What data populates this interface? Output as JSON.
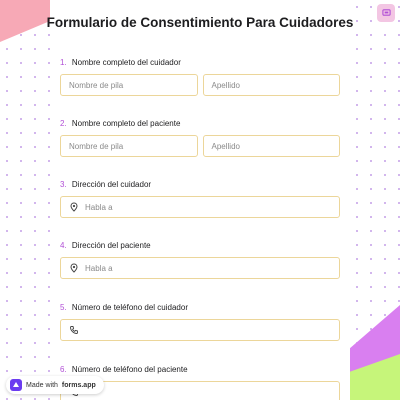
{
  "form": {
    "title": "Formulario de Consentimiento Para Cuidadores"
  },
  "questions": [
    {
      "number": "1.",
      "label": "Nombre completo del cuidador",
      "fields": [
        {
          "placeholder": "Nombre de pila"
        },
        {
          "placeholder": "Apellido"
        }
      ]
    },
    {
      "number": "2.",
      "label": "Nombre completo del paciente",
      "fields": [
        {
          "placeholder": "Nombre de pila"
        },
        {
          "placeholder": "Apellido"
        }
      ]
    },
    {
      "number": "3.",
      "label": "Dirección del cuidador",
      "fields": [
        {
          "placeholder": "Habla a",
          "icon": "location-pin-icon"
        }
      ]
    },
    {
      "number": "4.",
      "label": "Dirección del paciente",
      "fields": [
        {
          "placeholder": "Habla a",
          "icon": "location-pin-icon"
        }
      ]
    },
    {
      "number": "5.",
      "label": "Número de teléfono del cuidador",
      "fields": [
        {
          "placeholder": "",
          "icon": "phone-icon"
        }
      ]
    },
    {
      "number": "6.",
      "label": "Número de teléfono del paciente",
      "fields": [
        {
          "placeholder": "",
          "icon": "phone-icon"
        }
      ]
    }
  ],
  "badge": {
    "prefix": "Made with",
    "brand": "forms.app"
  },
  "colors": {
    "accent": "#b14fd6",
    "field_border": "#ecd69a",
    "pink": "#f7a9b6",
    "purple": "#d97ff0",
    "green": "#c6f57a"
  }
}
